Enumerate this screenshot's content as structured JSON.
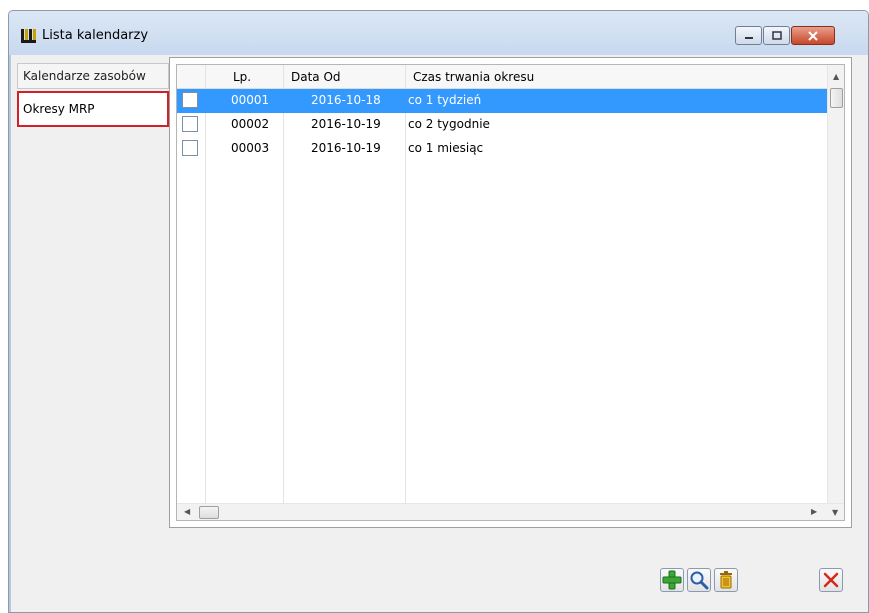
{
  "window": {
    "title": "Lista kalendarzy"
  },
  "tabs": [
    {
      "label": "Kalendarze zasobów"
    },
    {
      "label": "Okresy MRP"
    }
  ],
  "grid": {
    "headers": {
      "lp": "Lp.",
      "data_od": "Data Od",
      "czas": "Czas trwania okresu"
    },
    "rows": [
      {
        "lp": "00001",
        "data_od": "2016-10-18",
        "czas": "co 1 tydzień",
        "selected": true
      },
      {
        "lp": "00002",
        "data_od": "2016-10-19",
        "czas": "co 2 tygodnie",
        "selected": false
      },
      {
        "lp": "00003",
        "data_od": "2016-10-19",
        "czas": "co 1 miesiąc",
        "selected": false
      }
    ]
  },
  "icons": {
    "app": "calendar-list-icon",
    "add": "plus-icon",
    "view": "magnifier-icon",
    "delete": "trash-icon",
    "close": "close-x-icon"
  },
  "colors": {
    "selection": "#3399ff",
    "highlight_border": "#d0202a",
    "add_green": "#3aa635",
    "close_red": "#d42a1e"
  }
}
